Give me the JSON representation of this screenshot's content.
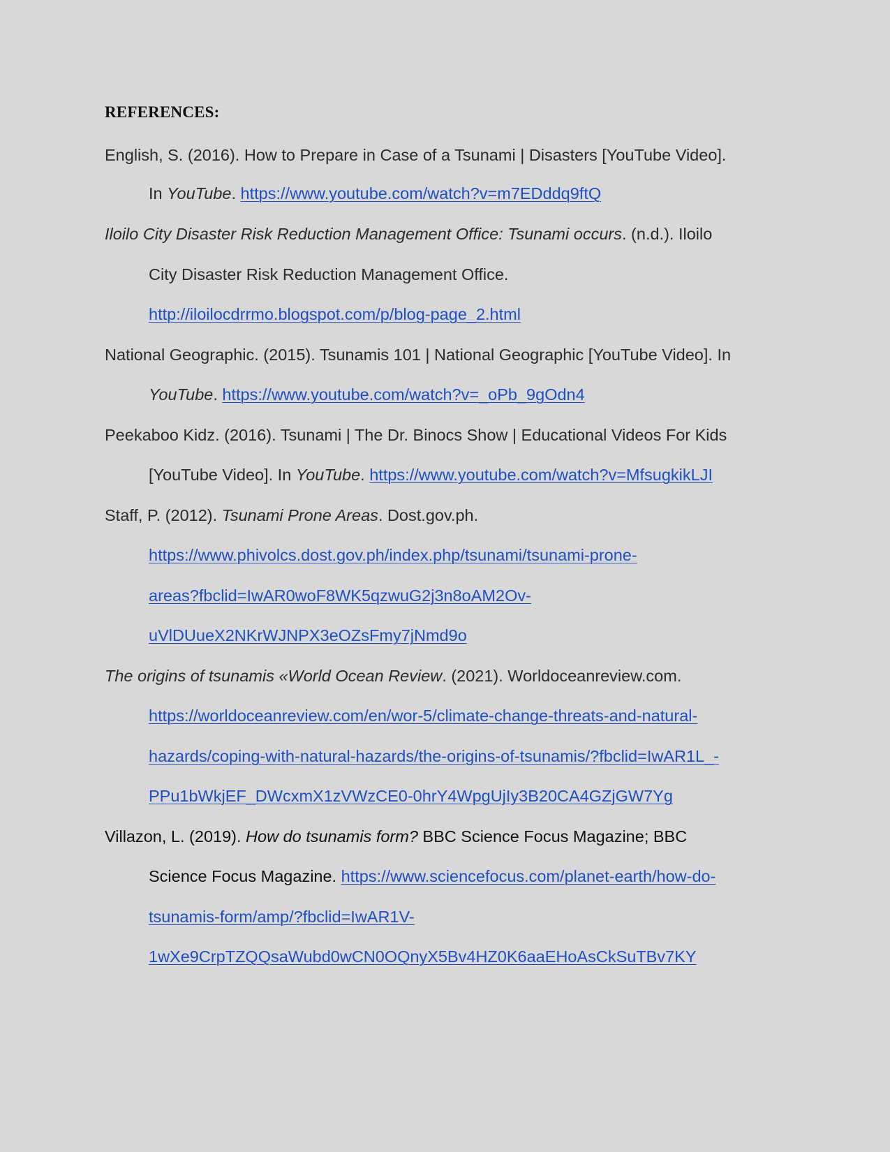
{
  "heading": "REFERENCES:",
  "refs": {
    "r1": {
      "a": "English, S. (2016). How to Prepare in Case of a Tsunami | Disasters [YouTube Video].",
      "b1": "In ",
      "b2": "YouTube",
      "b3": ". ",
      "url": "https://www.youtube.com/watch?v=m7EDddq9ftQ"
    },
    "r2": {
      "title": "Iloilo City Disaster Risk Reduction Management Office: Tsunami occurs",
      "rest": ". (n.d.). Iloilo",
      "line2": "City Disaster Risk Reduction Management Office.",
      "url": "http://iloilocdrrmo.blogspot.com/p/blog-page_2.html"
    },
    "r3": {
      "a": "National Geographic. (2015). Tsunamis 101 | National Geographic [YouTube Video]. In",
      "b1": "YouTube",
      "b2": ". ",
      "url": "https://www.youtube.com/watch?v=_oPb_9gOdn4"
    },
    "r4": {
      "a": "Peekaboo Kidz. (2016). Tsunami | The Dr. Binocs Show | Educational Videos For Kids",
      "b1": "[YouTube Video]. In ",
      "b2": "YouTube",
      "b3": ". ",
      "url": "https://www.youtube.com/watch?v=MfsugkikLJI"
    },
    "r5": {
      "a1": "Staff, P. (2012). ",
      "a2": "Tsunami Prone Areas",
      "a3": ". Dost.gov.ph.",
      "url1": "https://www.phivolcs.dost.gov.ph/index.php/tsunami/tsunami-prone-",
      "url2": "areas?fbclid=IwAR0woF8WK5qzwuG2j3n8oAM2Ov-",
      "url3": "uVlDUueX2NKrWJNPX3eOZsFmy7jNmd9o"
    },
    "r6": {
      "title": "The origins of tsunamis «World Ocean Review",
      "rest": ". (2021). Worldoceanreview.com.",
      "url1": "https://worldoceanreview.com/en/wor-5/climate-change-threats-and-natural-",
      "url2": "hazards/coping-with-natural-hazards/the-origins-of-tsunamis/?fbclid=IwAR1L_-",
      "url3": "PPu1bWkjEF_DWcxmX1zVWzCE0-0hrY4WpgUjIy3B20CA4GZjGW7Yg"
    },
    "r7": {
      "a1": "Villazon, L. (2019). ",
      "a2": "How do tsunamis form?",
      "a3": " BBC Science Focus Magazine; BBC",
      "b": "Science Focus Magazine. ",
      "url1": "https://www.sciencefocus.com/planet-earth/how-do-",
      "url2": "tsunamis-form/amp/?fbclid=IwAR1V-",
      "url3": "1wXe9CrpTZQQsaWubd0wCN0OQnyX5Bv4HZ0K6aaEHoAsCkSuTBv7KY"
    }
  }
}
